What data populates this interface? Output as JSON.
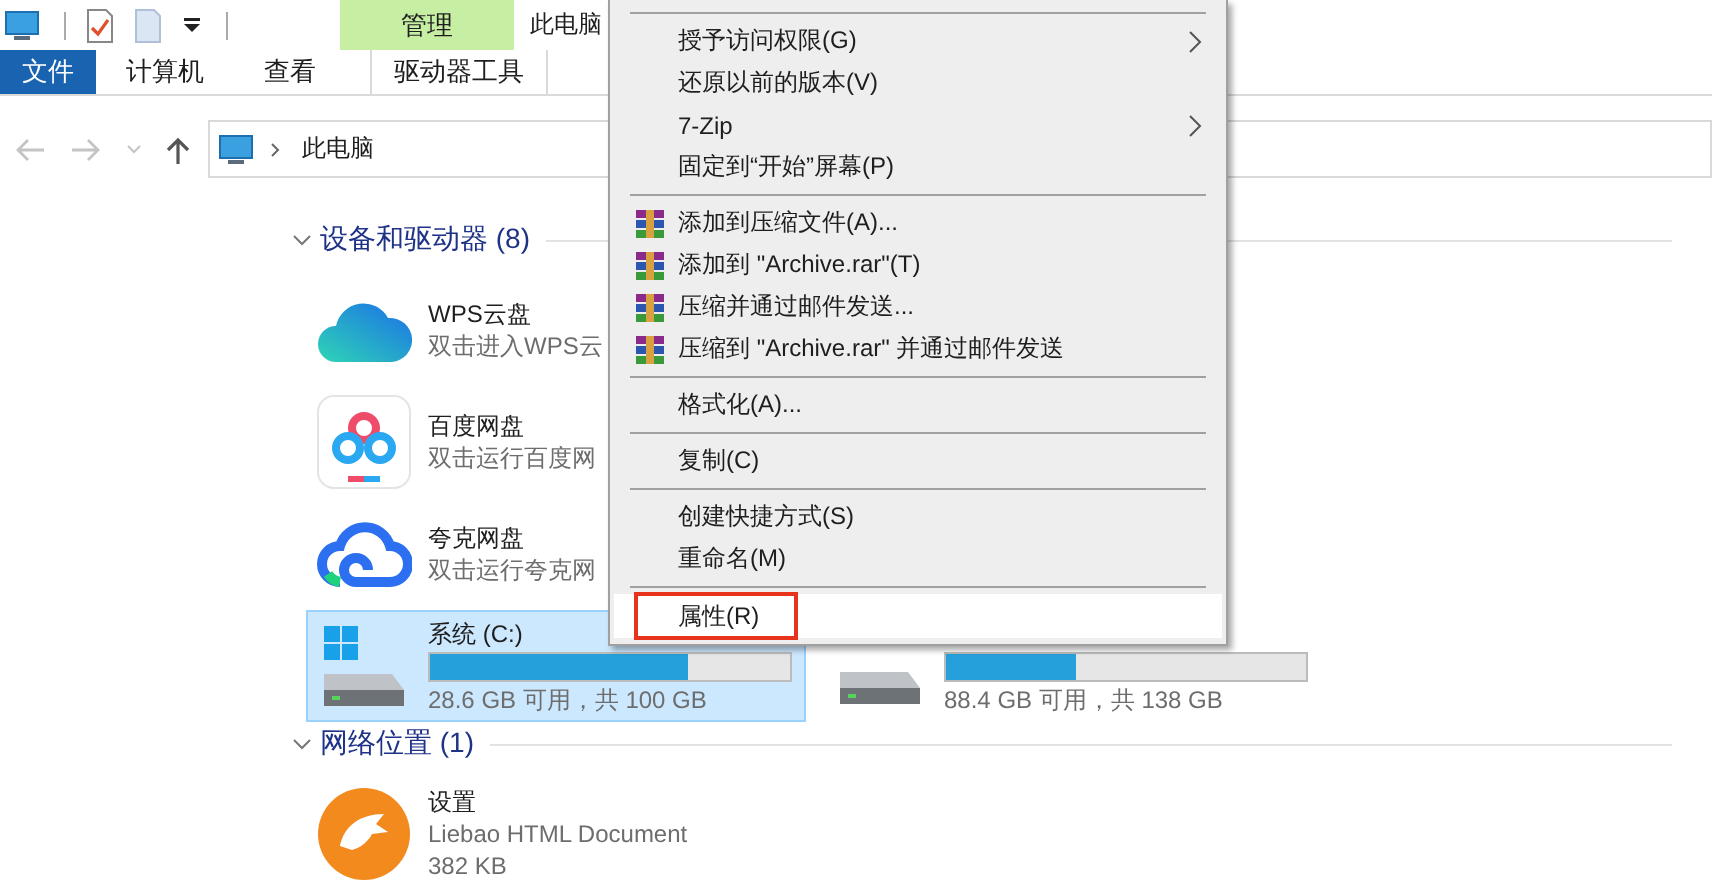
{
  "ribbon": {
    "context_group": "管理",
    "window_title": "此电脑",
    "tabs": [
      {
        "label": "文件",
        "kind": "file"
      },
      {
        "label": "计算机",
        "kind": "normal"
      },
      {
        "label": "查看",
        "kind": "normal"
      },
      {
        "label": "驱动器工具",
        "kind": "context"
      }
    ]
  },
  "address_bar": {
    "path": "此电脑"
  },
  "groups": [
    {
      "title": "设备和驱动器 (8)",
      "expanded": true,
      "rows": [
        {
          "items": [
            {
              "kind": "cloud",
              "name": "WPS云盘",
              "details": [
                "双击进入WPS云"
              ],
              "selected": false
            }
          ]
        },
        {
          "items": [
            {
              "kind": "baidu",
              "name": "百度网盘",
              "details": [
                "双击运行百度网"
              ],
              "selected": false
            }
          ]
        },
        {
          "items": [
            {
              "kind": "quark",
              "name": "夸克网盘",
              "details": [
                "双击运行夸克网"
              ],
              "selected": false
            }
          ]
        },
        {
          "items": [
            {
              "kind": "system_drive",
              "name": "系统 (C:)",
              "level": 0.714,
              "details": [
                "28.6 GB 可用，共 100 GB"
              ],
              "selected": true
            },
            {
              "kind": "drive",
              "level": 0.36,
              "details": [
                "88.4 GB 可用，共 138 GB"
              ],
              "selected": false
            }
          ]
        }
      ]
    },
    {
      "title": "网络位置 (1)",
      "expanded": true,
      "rows": [
        {
          "items": [
            {
              "kind": "document",
              "name": "设置",
              "details": [
                "Liebao HTML Document",
                "382 KB"
              ],
              "selected": false
            }
          ]
        }
      ]
    }
  ],
  "context_menu": {
    "items": [
      {
        "kind": "separator"
      },
      {
        "kind": "submenu",
        "label": "授予访问权限(G)",
        "highlighted": false,
        "marked": false
      },
      {
        "kind": "plain",
        "label": "还原以前的版本(V)",
        "highlighted": false,
        "marked": false
      },
      {
        "kind": "submenu",
        "label": "7-Zip",
        "highlighted": false,
        "marked": false
      },
      {
        "kind": "plain",
        "label": "固定到“开始”屏幕(P)",
        "highlighted": false,
        "marked": false
      },
      {
        "kind": "separator"
      },
      {
        "kind": "archive",
        "label": "添加到压缩文件(A)...",
        "highlighted": false,
        "marked": false
      },
      {
        "kind": "archive",
        "label": "添加到 \"Archive.rar\"(T)",
        "highlighted": false,
        "marked": false
      },
      {
        "kind": "archive",
        "label": "压缩并通过邮件发送...",
        "highlighted": false,
        "marked": false
      },
      {
        "kind": "archive",
        "label": "压缩到 \"Archive.rar\" 并通过邮件发送",
        "highlighted": false,
        "marked": false
      },
      {
        "kind": "separator"
      },
      {
        "kind": "plain",
        "label": "格式化(A)...",
        "highlighted": false,
        "marked": false
      },
      {
        "kind": "separator"
      },
      {
        "kind": "plain",
        "label": "复制(C)",
        "highlighted": false,
        "marked": false
      },
      {
        "kind": "separator"
      },
      {
        "kind": "plain",
        "label": "创建快捷方式(S)",
        "highlighted": false,
        "marked": false
      },
      {
        "kind": "plain",
        "label": "重命名(M)",
        "highlighted": false,
        "marked": false
      },
      {
        "kind": "separator"
      },
      {
        "kind": "plain",
        "label": "属性(R)",
        "highlighted": true,
        "marked": true
      }
    ]
  }
}
